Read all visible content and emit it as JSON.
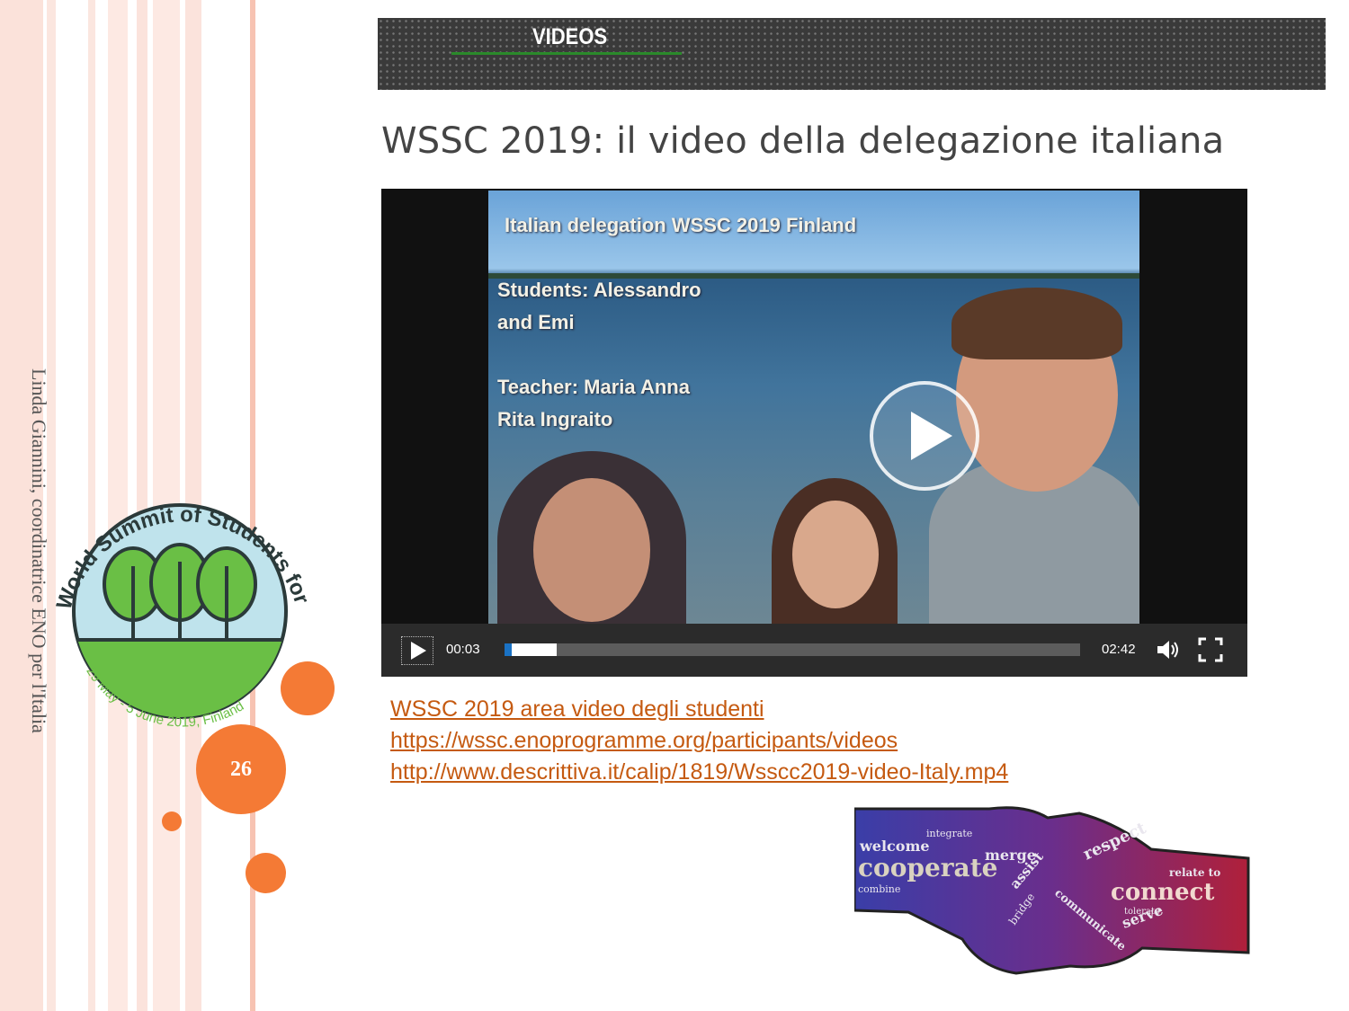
{
  "slide": {
    "author_vertical": "Linda Giannini, coordinatrice ENO per l'Italia",
    "page_number": "26",
    "accent_color": "#f47a35",
    "link_color": "#c55a11"
  },
  "logo": {
    "arc_top": "World Summit of Students for Climate",
    "arc_bottom": "29 May - 5 June 2019, Finland"
  },
  "banner": {
    "title": "VIDEOS"
  },
  "page_title": "WSSC 2019: il video della delegazione  italiana",
  "video": {
    "overlay_title": "Italian delegation WSSC 2019 Finland",
    "students_line1": "Students: Alessandro",
    "students_line2": "and Emi",
    "teacher_line1": "Teacher: Maria Anna",
    "teacher_line2": "Rita Ingraito",
    "current_time": "00:03",
    "duration": "02:42",
    "progress_fraction": 0.09,
    "icons": [
      "play-icon",
      "volume-icon",
      "fullscreen-icon",
      "big-play-icon"
    ]
  },
  "links": [
    "WSSC 2019 area video degli studenti",
    "https://wssc.enoprogramme.org/participants/videos",
    "http://www.descrittiva.it/calip/1819/Wsscc2019-video-Italy.mp4"
  ],
  "handshake_words": [
    "welcome",
    "cooperate",
    "integrate",
    "merge",
    "assist",
    "communicate",
    "respect",
    "connect",
    "serve",
    "combine",
    "bridge",
    "relate to",
    "tolerate"
  ]
}
